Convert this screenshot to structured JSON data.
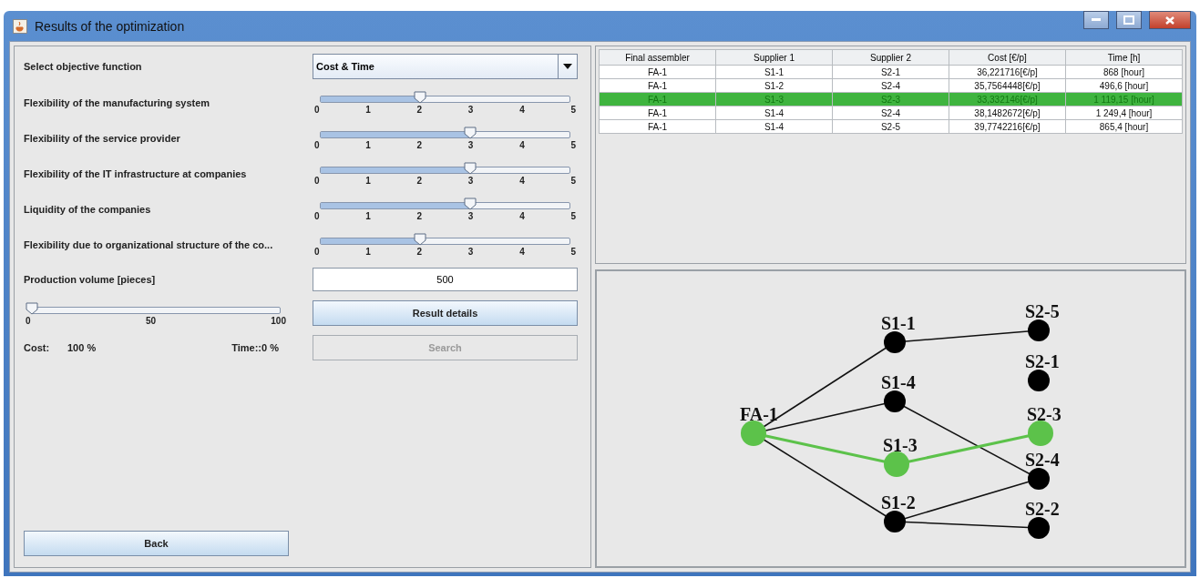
{
  "window": {
    "title": "Results of the optimization"
  },
  "objective": {
    "label": "Select objective function",
    "value": "Cost & Time"
  },
  "sliders": [
    {
      "label": "Flexibility of the manufacturing system",
      "level": 0.4,
      "ticks": [
        "0",
        "1",
        "2",
        "3",
        "4",
        "5"
      ]
    },
    {
      "label": "Flexibility of the service provider",
      "level": 0.6,
      "ticks": [
        "0",
        "1",
        "2",
        "3",
        "4",
        "5"
      ]
    },
    {
      "label": "Flexibility of the IT infrastructure at companies",
      "level": 0.6,
      "ticks": [
        "0",
        "1",
        "2",
        "3",
        "4",
        "5"
      ]
    },
    {
      "label": "Liquidity of the companies",
      "level": 0.6,
      "ticks": [
        "0",
        "1",
        "2",
        "3",
        "4",
        "5"
      ]
    },
    {
      "label": "Flexibility due to organizational structure of the co...",
      "level": 0.4,
      "ticks": [
        "0",
        "1",
        "2",
        "3",
        "4",
        "5"
      ]
    }
  ],
  "production": {
    "label": "Production volume [pieces]",
    "value": "500",
    "level": 0,
    "ticks": [
      "0",
      "50",
      "100"
    ]
  },
  "result_details_button": "Result details",
  "search_button": {
    "label": "Search",
    "disabled": true
  },
  "cost": {
    "label": "Cost:",
    "value": "100 %"
  },
  "time": "Time::0 %",
  "back_button": "Back",
  "table": {
    "columns": [
      "Final assembler",
      "Supplier 1",
      "Supplier 2",
      "Cost [€/p]",
      "Time [h]"
    ],
    "rows": [
      {
        "cells": [
          "FA-1",
          "S1-1",
          "S2-1",
          "36,221716[€/p]",
          "868 [hour]"
        ],
        "selected": false
      },
      {
        "cells": [
          "FA-1",
          "S1-2",
          "S2-4",
          "35,7564448[€/p]",
          "496,6 [hour]"
        ],
        "selected": false
      },
      {
        "cells": [
          "FA-1",
          "S1-3",
          "S2-3",
          "33,332146[€/p]",
          "1 119,15 [hour]"
        ],
        "selected": true
      },
      {
        "cells": [
          "FA-1",
          "S1-4",
          "S2-4",
          "38,1482672[€/p]",
          "1 249,4 [hour]"
        ],
        "selected": false
      },
      {
        "cells": [
          "FA-1",
          "S1-4",
          "S2-5",
          "39,7742216[€/p]",
          "865,4 [hour]"
        ],
        "selected": false
      }
    ]
  },
  "graph": {
    "nodes": [
      {
        "label": "FA-1",
        "selected": true
      },
      {
        "label": "S1-1",
        "selected": false
      },
      {
        "label": "S1-4",
        "selected": false
      },
      {
        "label": "S1-3",
        "selected": true
      },
      {
        "label": "S1-2",
        "selected": false
      },
      {
        "label": "S2-5",
        "selected": false
      },
      {
        "label": "S2-1",
        "selected": false
      },
      {
        "label": "S2-3",
        "selected": true
      },
      {
        "label": "S2-4",
        "selected": false
      },
      {
        "label": "S2-2",
        "selected": false
      }
    ],
    "edges": [
      {
        "selected": false
      },
      {
        "selected": false
      },
      {
        "selected": true
      },
      {
        "selected": false
      },
      {
        "selected": false
      },
      {
        "selected": false
      },
      {
        "selected": true
      },
      {
        "selected": false
      },
      {
        "selected": false
      }
    ]
  }
}
